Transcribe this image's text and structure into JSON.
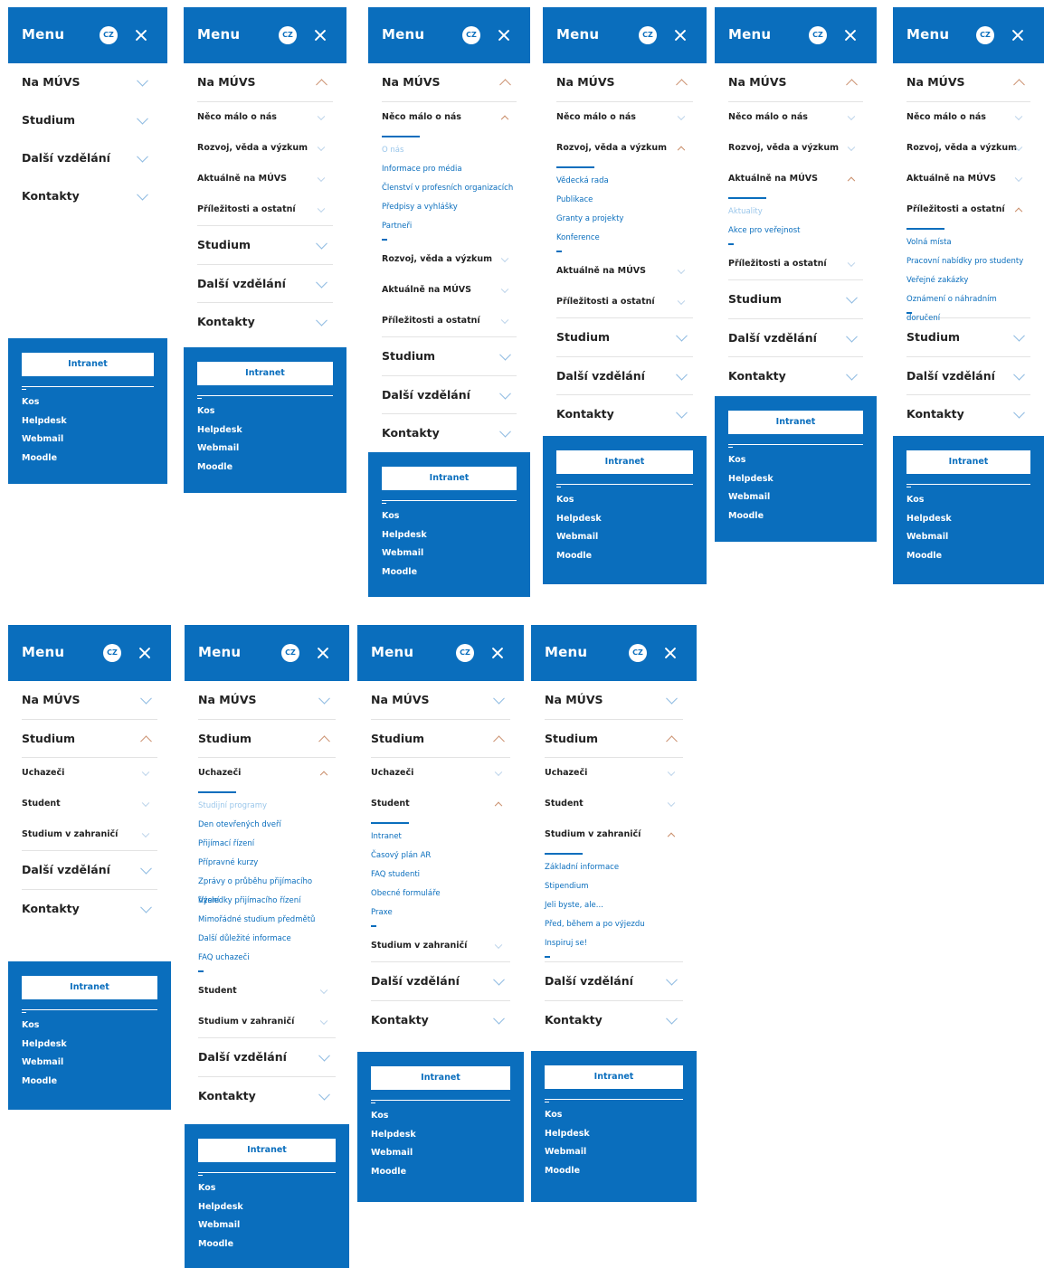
{
  "menu": {
    "title": "Menu",
    "lang": "CZ"
  },
  "top": [
    "Na MÚVS",
    "Studium",
    "Další vzdělání",
    "Kontakty"
  ],
  "na_muvs_sections": [
    "Něco málo o nás",
    "Rozvoj, věda a výzkum",
    "Aktuálně na MÚVS",
    "Příležitosti a ostatní"
  ],
  "studium_sections": [
    "Uchazeči",
    "Student",
    "Studium v zahraničí"
  ],
  "sub": {
    "neco": [
      "O nás",
      "Informace pro média",
      "Členství v profesních organizacích",
      "Předpisy a vyhlášky",
      "Partneři"
    ],
    "rozvoj": [
      "Vědecká rada",
      "Publikace",
      "Granty a projekty",
      "Konference"
    ],
    "aktualne": [
      "Aktuality",
      "Akce pro veřejnost"
    ],
    "prilezitosti": [
      "Volná místa",
      "Pracovní nabídky pro studenty",
      "Veřejné zakázky",
      "Oznámení o náhradním doručení"
    ],
    "uchazeci": [
      "Studijní programy",
      "Den otevřených dveří",
      "Přijímací řízení",
      "Přípravné kurzy",
      "Zprávy o průběhu přijímacího řízení",
      "Výsledky přijímacího řízení",
      "Mimořádné studium předmětů",
      "Další důležité informace",
      "FAQ uchazeči"
    ],
    "student": [
      "Intranet",
      "Časový plán AR",
      "FAQ studenti",
      "Obecné formuláře",
      "Praxe"
    ],
    "zahranici": [
      "Základní informace",
      "Stipendium",
      "Jeli byste, ale...",
      "Před, během a po výjezdu",
      "Inspiruj se!"
    ]
  },
  "footer": {
    "intranet": "Intranet",
    "links": [
      "Kos",
      "Helpdesk",
      "Webmail",
      "Moodle"
    ]
  },
  "colors": {
    "brand_blue": "#0a6ebd",
    "open_chevron": "#c98d6a"
  }
}
